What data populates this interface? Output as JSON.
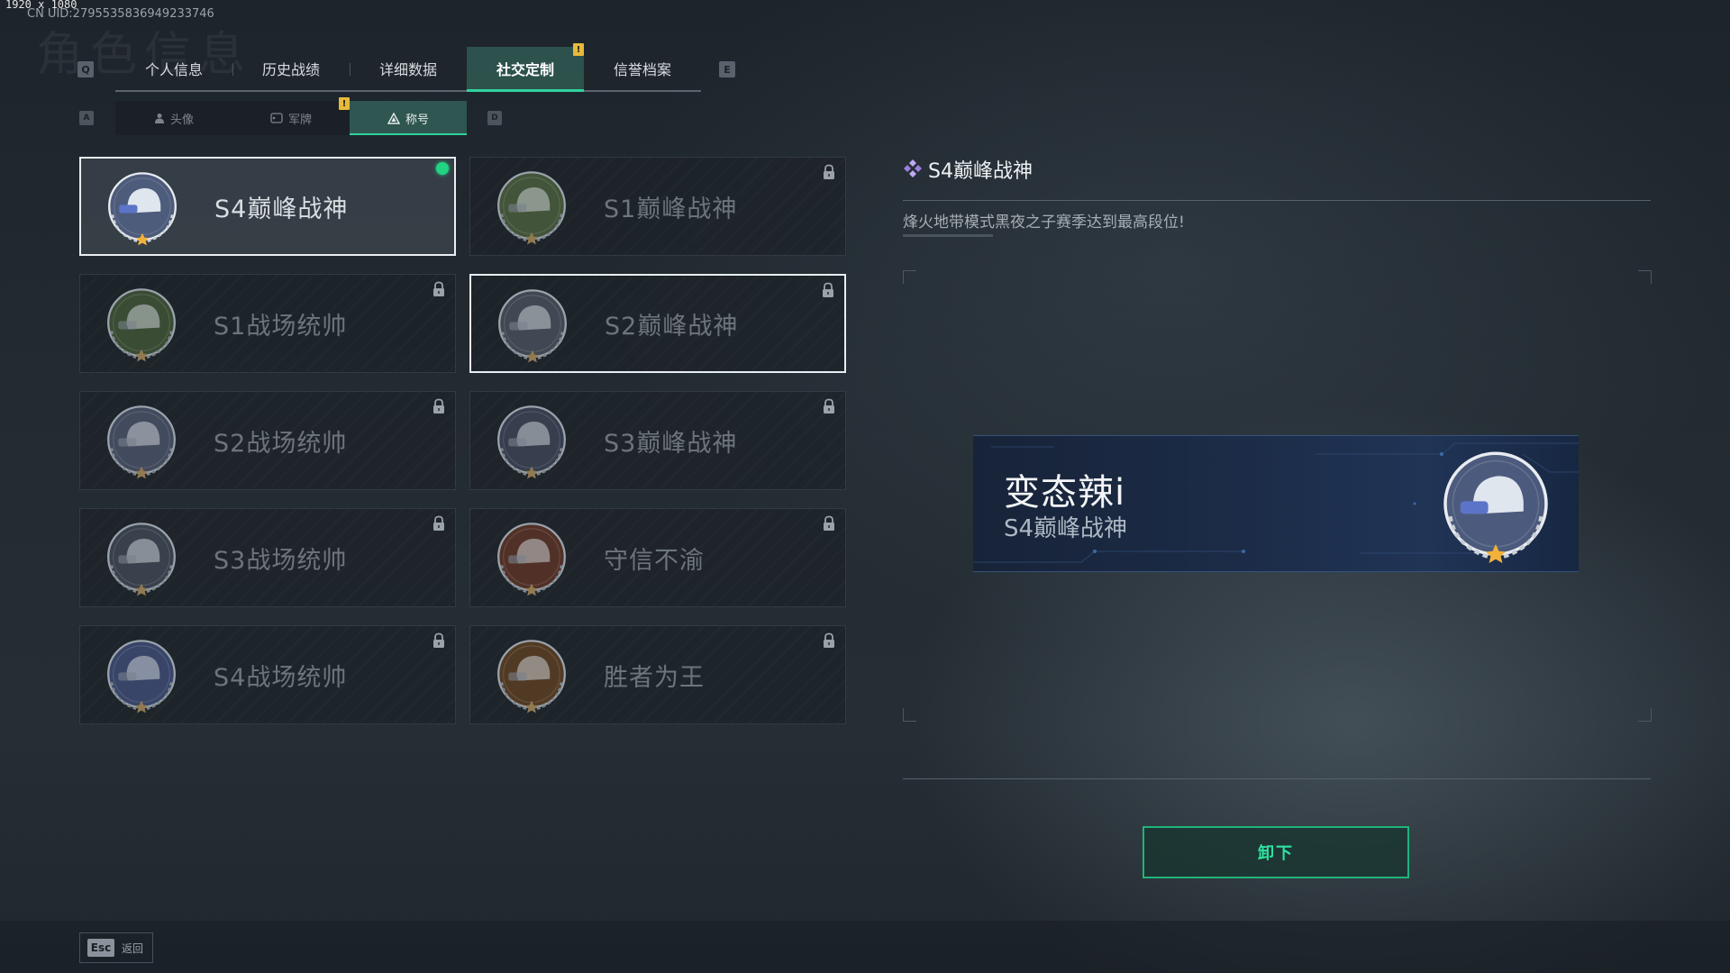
{
  "header": {
    "resolution": "1920 x 1080",
    "uid": "CN UID:2795535836949233746",
    "ghost_title": "角色信息",
    "prev_key": "Q",
    "next_key": "E"
  },
  "main_tabs": [
    {
      "label": "个人信息"
    },
    {
      "label": "历史战绩"
    },
    {
      "label": "详细数据"
    },
    {
      "label": "社交定制",
      "active": true,
      "badge": "!"
    },
    {
      "label": "信誉档案"
    }
  ],
  "sub_tabs": {
    "prev_key": "A",
    "next_key": "D",
    "items": [
      {
        "label": "头像",
        "icon": "person-icon"
      },
      {
        "label": "军牌",
        "icon": "dogtag-icon",
        "badge": "!"
      },
      {
        "label": "称号",
        "icon": "triangle-icon",
        "active": true
      }
    ]
  },
  "titles": [
    {
      "label": "S4巅峰战神",
      "emblem": "night-vision-helmet-emblem",
      "equipped": true,
      "locked": false,
      "color": "#7f93c8"
    },
    {
      "label": "S1巅峰战神",
      "emblem": "crocodile-emblem",
      "locked": true,
      "color": "#6f8a55"
    },
    {
      "label": "S1战场统帅",
      "emblem": "tank-emblem",
      "locked": true,
      "color": "#5f7a4a"
    },
    {
      "label": "S2巅峰战神",
      "emblem": "triangle-gear-emblem",
      "locked": true,
      "hover": true,
      "color": "#6a7384"
    },
    {
      "label": "S2战场统帅",
      "emblem": "helicopter-emblem",
      "locked": true,
      "color": "#6d7794"
    },
    {
      "label": "S3巅峰战神",
      "emblem": "eagle-globe-emblem",
      "locked": true,
      "color": "#59627a"
    },
    {
      "label": "S3战场统帅",
      "emblem": "armored-vehicle-emblem",
      "locked": true,
      "color": "#5e6678"
    },
    {
      "label": "守信不渝",
      "emblem": "scales-emblem",
      "locked": true,
      "color": "#8a4a34"
    },
    {
      "label": "S4战场统帅",
      "emblem": "missile-emblem",
      "locked": true,
      "color": "#5d6fa8"
    },
    {
      "label": "胜者为王",
      "emblem": "medal-emblem",
      "locked": true,
      "color": "#8a5a2e"
    }
  ],
  "detail": {
    "title": "S4巅峰战神",
    "description": "烽火地带模式黑夜之子赛季达到最高段位!",
    "icon": "diamond-icon",
    "accent": "#a98bea"
  },
  "preview": {
    "player_name": "变态辣i",
    "title": "S4巅峰战神"
  },
  "actions": {
    "unequip_label": "卸下",
    "back_key": "Esc",
    "back_label": "返回"
  }
}
